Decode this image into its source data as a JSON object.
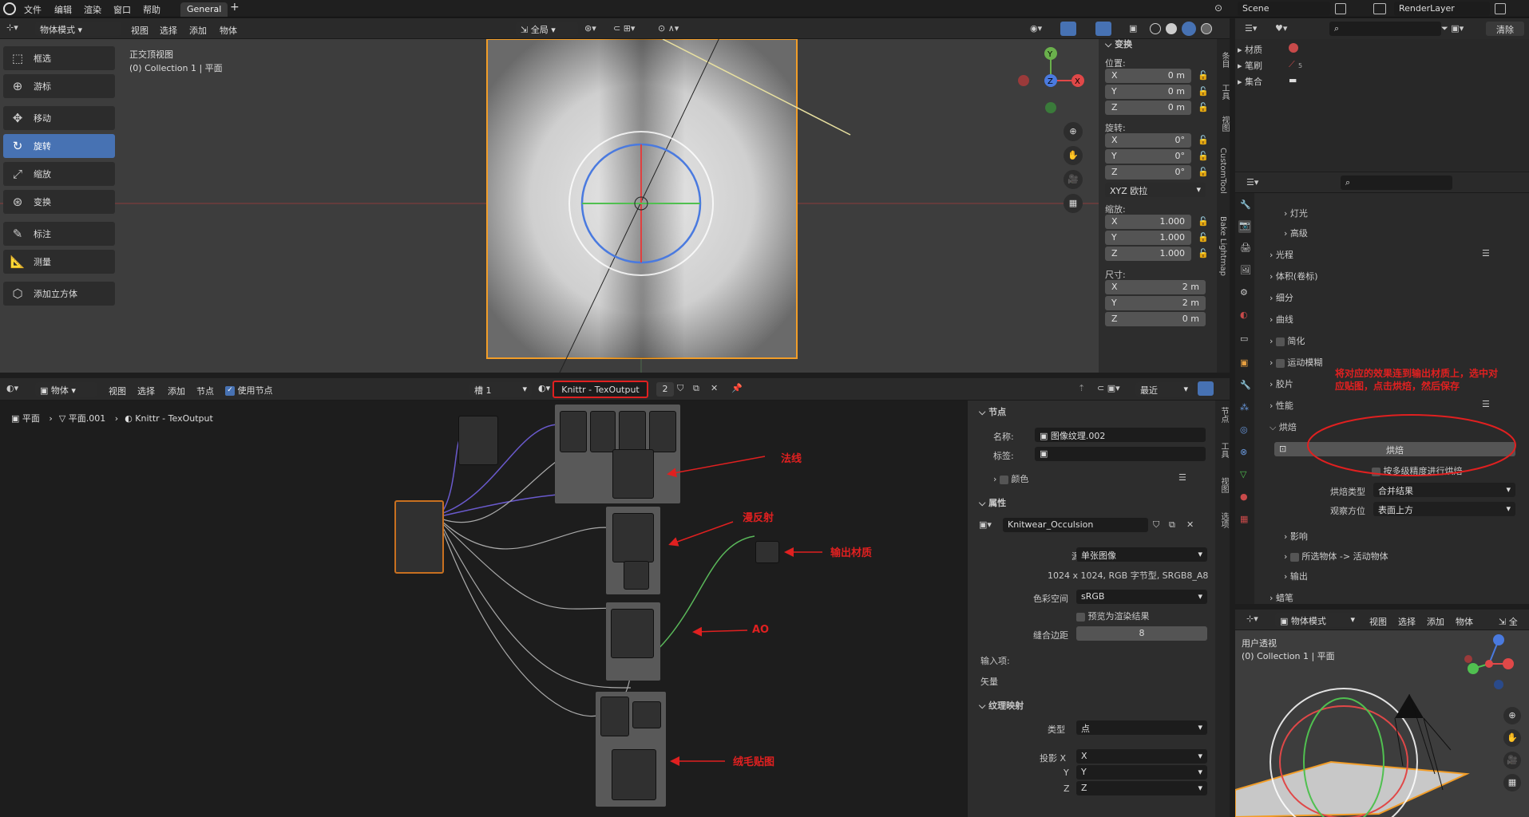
{
  "topbar": {
    "menus": [
      "文件",
      "编辑",
      "渲染",
      "窗口",
      "帮助"
    ],
    "workspace_tab": "General",
    "add_tab": "+",
    "scene_name": "Scene",
    "view_layer": "RenderLayer"
  },
  "viewport_header": {
    "mode": "物体模式",
    "menus": [
      "视图",
      "选择",
      "添加",
      "物体"
    ],
    "transform_orientation": "全局"
  },
  "viewport": {
    "view_name": "正交顶视图",
    "collection_info": "(0) Collection 1 | 平面"
  },
  "tools": [
    "框选",
    "游标",
    "移动",
    "旋转",
    "缩放",
    "变换",
    "标注",
    "测量",
    "添加立方体"
  ],
  "active_tool": "旋转",
  "transform_panel": {
    "title": "变换",
    "location_label": "位置:",
    "location": [
      {
        "axis": "X",
        "value": "0 m"
      },
      {
        "axis": "Y",
        "value": "0 m"
      },
      {
        "axis": "Z",
        "value": "0 m"
      }
    ],
    "rotation_label": "旋转:",
    "rotation": [
      {
        "axis": "X",
        "value": "0°"
      },
      {
        "axis": "Y",
        "value": "0°"
      },
      {
        "axis": "Z",
        "value": "0°"
      }
    ],
    "rotation_mode": "XYZ 欧拉",
    "scale_label": "缩放:",
    "scale": [
      {
        "axis": "X",
        "value": "1.000"
      },
      {
        "axis": "Y",
        "value": "1.000"
      },
      {
        "axis": "Z",
        "value": "1.000"
      }
    ],
    "dimensions_label": "尺寸:",
    "dimensions": [
      {
        "axis": "X",
        "value": "2 m"
      },
      {
        "axis": "Y",
        "value": "2 m"
      },
      {
        "axis": "Z",
        "value": "0 m"
      }
    ]
  },
  "viewport_side_tabs": [
    "条目",
    "工具",
    "视图",
    "CustomTool",
    "Bake Lightmap"
  ],
  "outliner": {
    "items": [
      "材质",
      "笔刷",
      "集合"
    ],
    "brush_count": "5",
    "clear_btn": "清除"
  },
  "properties": {
    "rows_top": [
      "灯光",
      "高级"
    ],
    "sections": [
      "光程",
      "体积(卷标)",
      "细分",
      "曲线",
      "简化",
      "运动模糊",
      "胶片",
      "性能",
      "烘焙"
    ],
    "bake_button": "烘焙",
    "multires_label": "按多级精度进行烘焙",
    "bake_type_label": "烘焙类型",
    "bake_type_value": "合并结果",
    "view_from_label": "观察方位",
    "view_from_value": "表面上方",
    "subsections": [
      "影响",
      "所选物体 -> 活动物体",
      "输出"
    ],
    "grease_pencil": "蜡笔",
    "annotation": "将对应的效果连到输出材质上，选中对应贴图，点击烘焙，然后保存"
  },
  "node_header": {
    "mode": "物体",
    "menus": [
      "视图",
      "选择",
      "添加",
      "节点"
    ],
    "use_nodes": "使用节点",
    "slot": "槽 1",
    "material_name": "Knittr - TexOutput",
    "users": "2",
    "recent": "最近"
  },
  "breadcrumb": [
    "平面",
    "平面.001",
    "Knittr - TexOutput"
  ],
  "node_annotations": [
    "法线",
    "漫反射",
    "输出材质",
    "AO",
    "绒毛贴图"
  ],
  "node_sidebar": {
    "node_section": "节点",
    "name_label": "名称:",
    "name_value": "图像纹理.002",
    "label_label": "标签:",
    "color_label": "颜色",
    "props_section": "属性",
    "image_name": "Knitwear_Occulsion",
    "source_label": "源",
    "source_value": "单张图像",
    "image_info": "1024 x 1024, RGB 字节型, SRGB8_A8",
    "colorspace_label": "色彩空间",
    "colorspace_value": "sRGB",
    "preview_label": "预览为渲染结果",
    "margin_label": "缝合边距",
    "margin_value": "8",
    "input_label": "输入项:",
    "vector_label": "矢量",
    "mapping_section": "纹理映射",
    "type_label": "类型",
    "type_value": "点",
    "projection_label": "投影 X",
    "proj_x": "X",
    "y_label": "Y",
    "proj_y": "Y",
    "z_label": "Z",
    "proj_z": "Z"
  },
  "node_side_tabs": [
    "节点",
    "工具",
    "视图",
    "选项"
  ],
  "mini_viewport": {
    "mode": "物体模式",
    "menus": [
      "视图",
      "选择",
      "添加",
      "物体"
    ],
    "extra": "全",
    "view_name": "用户透视",
    "collection_info": "(0) Collection 1 | 平面"
  },
  "colors": {
    "accent": "#4772b3",
    "annotation_red": "#e02020",
    "selection_orange": "#f29d28"
  }
}
